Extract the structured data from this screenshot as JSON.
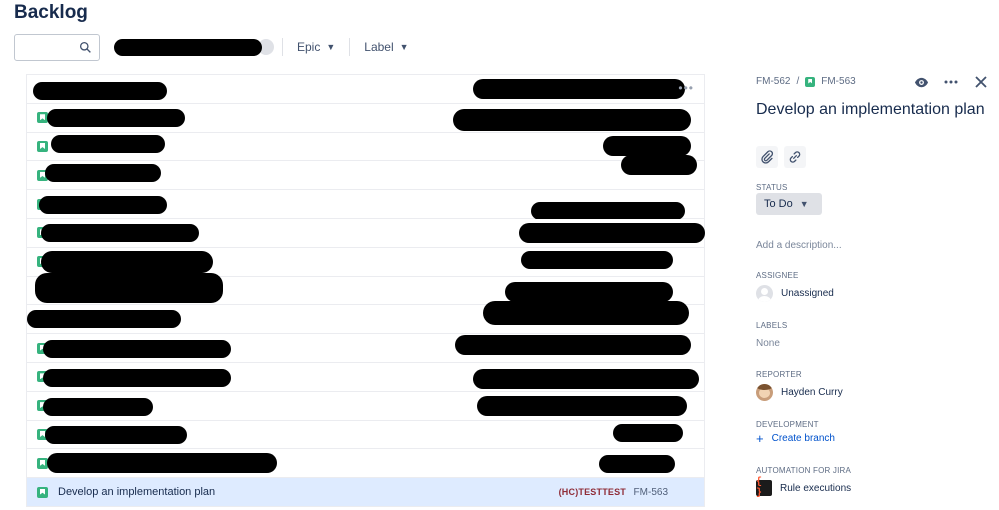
{
  "page": {
    "title": "Backlog"
  },
  "toolbar": {
    "search_placeholder": "",
    "filters": [
      {
        "label": "Epic"
      },
      {
        "label": "Label"
      }
    ]
  },
  "backlog": {
    "selected_row": {
      "summary": "Develop an implementation plan",
      "epic": "(HC)TESTTEST",
      "key": "FM-563"
    }
  },
  "detail": {
    "breadcrumb_parent": "FM-562",
    "breadcrumb_separator": "/",
    "breadcrumb_current": "FM-563",
    "title": "Develop an implementation plan",
    "status_label": "STATUS",
    "status_value": "To Do",
    "description_placeholder": "Add a description...",
    "assignee_label": "ASSIGNEE",
    "assignee_value": "Unassigned",
    "labels_label": "LABELS",
    "labels_value": "None",
    "reporter_label": "REPORTER",
    "reporter_value": "Hayden Curry",
    "development_label": "DEVELOPMENT",
    "create_branch": "Create branch",
    "automation_label": "AUTOMATION FOR JIRA",
    "rule_executions": "Rule executions"
  },
  "colors": {
    "story": "#36b37e",
    "selected_row": "#deebff",
    "epic_text": "#8f2b36",
    "link": "#0052cc"
  }
}
